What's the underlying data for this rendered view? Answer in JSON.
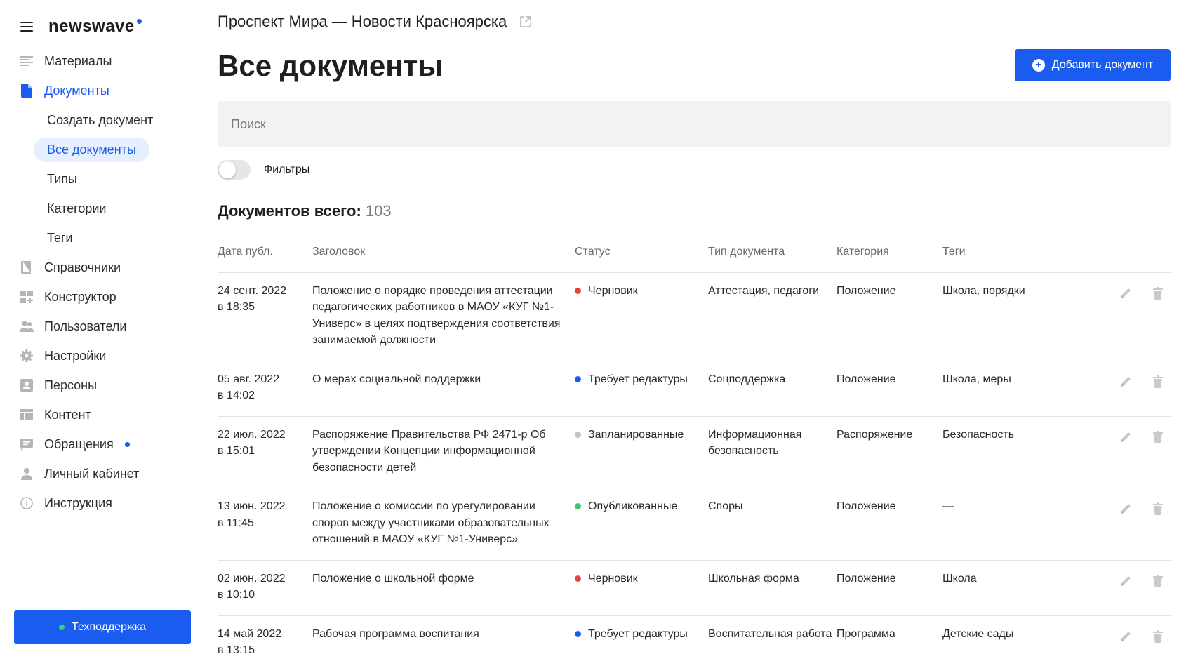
{
  "sidebar": {
    "logo": "newswave",
    "nav": [
      {
        "label": "Материалы",
        "icon": "materials-icon"
      },
      {
        "label": "Документы",
        "icon": "document-icon",
        "active": true
      },
      {
        "label": "Справочники",
        "icon": "book-icon"
      },
      {
        "label": "Конструктор",
        "icon": "grid-plus-icon"
      },
      {
        "label": "Пользователи",
        "icon": "users-icon"
      },
      {
        "label": "Настройки",
        "icon": "gear-icon"
      },
      {
        "label": "Персоны",
        "icon": "person-card-icon"
      },
      {
        "label": "Контент",
        "icon": "layout-icon"
      },
      {
        "label": "Обращения",
        "icon": "chat-icon",
        "has_notification": true
      },
      {
        "label": "Личный кабинет",
        "icon": "user-icon"
      },
      {
        "label": "Инструкция",
        "icon": "info-icon"
      }
    ],
    "sub_nav": [
      {
        "label": "Создать документ"
      },
      {
        "label": "Все документы",
        "active": true
      },
      {
        "label": "Типы"
      },
      {
        "label": "Категории"
      },
      {
        "label": "Теги"
      }
    ],
    "support_label": "Техподдержка"
  },
  "header": {
    "site_name": "Проспект Мира — Новости Красноярска",
    "page_title": "Все документы",
    "add_button": "Добавить документ"
  },
  "search": {
    "placeholder": "Поиск"
  },
  "filters": {
    "label": "Фильтры",
    "enabled": false
  },
  "summary": {
    "label": "Документов всего:",
    "count": "103"
  },
  "table": {
    "columns": [
      "Дата публ.",
      "Заголовок",
      "Статус",
      "Тип документа",
      "Категория",
      "Теги"
    ],
    "rows": [
      {
        "date": "24 сент. 2022",
        "time": "в 18:35",
        "title": "Положение о порядке проведения аттестации педагогических работников в МАОУ «КУГ №1-Универс» в целях подтверждения соответствия занимаемой должности",
        "status": "Черновик",
        "status_color": "#e8423f",
        "type": "Аттестация, педагоги",
        "category": "Положение",
        "tags": "Школа, порядки"
      },
      {
        "date": "05 авг. 2022",
        "time": "в 14:02",
        "title": "О мерах социальной поддержки",
        "status": "Требует редактуры",
        "status_color": "#1a5cf0",
        "type": "Соцподдержка",
        "category": "Положение",
        "tags": "Школа, меры"
      },
      {
        "date": "22 июл. 2022",
        "time": "в 15:01",
        "title": "Распоряжение Правительства РФ 2471-р Об утверждении Концепции информационной безопасности детей",
        "status": "Запланированные",
        "status_color": "#c4c4c4",
        "type": "Информационная безопасность",
        "category": "Распоряжение",
        "tags": "Безопасность"
      },
      {
        "date": "13 июн. 2022",
        "time": "в 11:45",
        "title": "Положение о комиссии по урегулировании споров между участниками образовательных отношений в МАОУ «КУГ №1-Универс»",
        "status": "Опубликованные",
        "status_color": "#3cc86b",
        "type": "Споры",
        "category": "Положение",
        "tags": "—"
      },
      {
        "date": "02 июн. 2022",
        "time": "в 10:10",
        "title": "Положение о школьной форме",
        "status": "Черновик",
        "status_color": "#e8423f",
        "type": "Школьная форма",
        "category": "Положение",
        "tags": "Школа"
      },
      {
        "date": "14 май 2022",
        "time": "в 13:15",
        "title": "Рабочая программа воспитания",
        "status": "Требует редактуры",
        "status_color": "#1a5cf0",
        "type": "Воспитательная работа",
        "category": "Программа",
        "tags": "Детские сады"
      }
    ]
  }
}
